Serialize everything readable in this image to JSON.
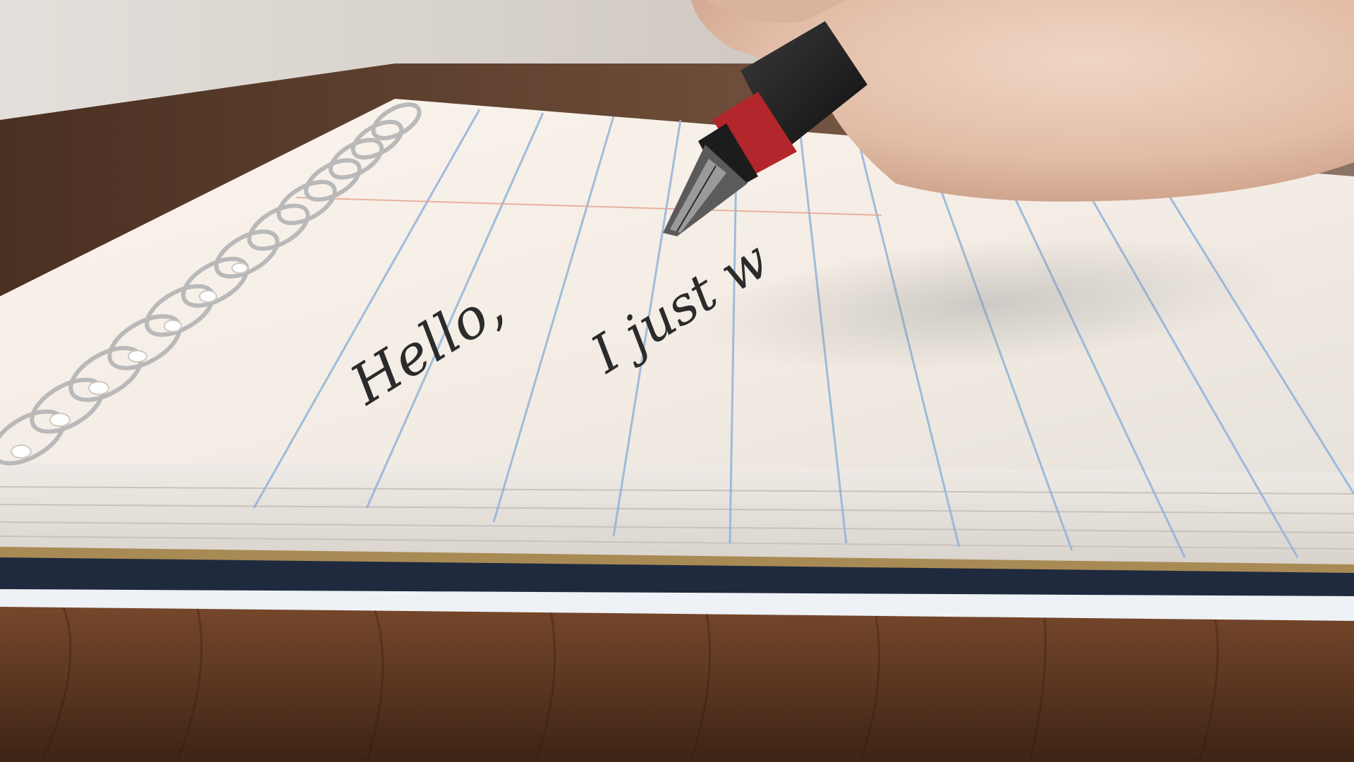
{
  "scene": {
    "description_type": "photo",
    "colors": {
      "wall": "#d9d4cf",
      "desk": "#6b4128",
      "desk_dark": "#3a2416",
      "paper": "#f6efe6",
      "paper_shadow": "#d8cfc6",
      "rule_line": "#8fb3d9",
      "margin_line": "#e5a08f",
      "ink": "#2b2b2b",
      "spiral": "#b9b9b9",
      "cover": "#1f2a3e",
      "pen_body": "#1b1b1b",
      "pen_band": "#b3262b",
      "skin": "#e7c7b3"
    }
  },
  "handwriting": {
    "line1": "Hello,",
    "line2": "I just w"
  }
}
